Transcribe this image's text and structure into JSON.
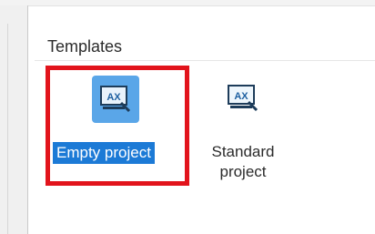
{
  "section": {
    "label": "Templates"
  },
  "templates": [
    {
      "label": "Empty project",
      "icon": "ax-project-icon",
      "selected": true
    },
    {
      "label_line1": "Standard",
      "label_line2": "project",
      "icon": "ax-project-icon",
      "selected": false
    }
  ],
  "colors": {
    "highlight_border": "#e2141c",
    "selection_bg": "#1c7ad6",
    "icon_selected_bg": "#5aa6e8"
  }
}
